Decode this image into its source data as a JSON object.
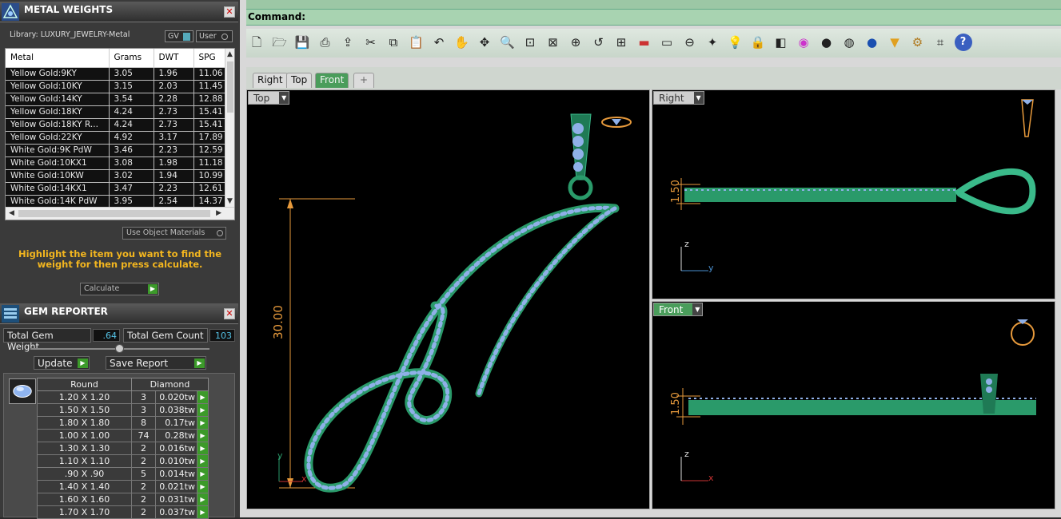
{
  "metal_panel": {
    "title": "METAL WEIGHTS",
    "library_label": "Library: LUXURY_JEWELRY-Metal",
    "toggle_gv": "GV",
    "toggle_user": "User",
    "columns": [
      "Metal",
      "Grams",
      "DWT",
      "SPG"
    ],
    "rows": [
      [
        "Yellow Gold:9KY",
        "3.05",
        "1.96",
        "11.06"
      ],
      [
        "Yellow Gold:10KY",
        "3.15",
        "2.03",
        "11.45"
      ],
      [
        "Yellow Gold:14KY",
        "3.54",
        "2.28",
        "12.88"
      ],
      [
        "Yellow Gold:18KY",
        "4.24",
        "2.73",
        "15.41"
      ],
      [
        "Yellow Gold:18KY R...",
        "4.24",
        "2.73",
        "15.41"
      ],
      [
        "Yellow Gold:22KY",
        "4.92",
        "3.17",
        "17.89"
      ],
      [
        "White Gold:9K PdW",
        "3.46",
        "2.23",
        "12.59"
      ],
      [
        "White Gold:10KX1",
        "3.08",
        "1.98",
        "11.18"
      ],
      [
        "White Gold:10KW",
        "3.02",
        "1.94",
        "10.99"
      ],
      [
        "White Gold:14KX1",
        "3.47",
        "2.23",
        "12.61"
      ],
      [
        "White Gold:14K PdW",
        "3.95",
        "2.54",
        "14.37"
      ]
    ],
    "use_object_materials": "Use Object Materials",
    "hint": "Highlight the item you want to find the weight for then press calculate.",
    "calculate": "Calculate"
  },
  "gem_panel": {
    "title": "GEM REPORTER",
    "total_weight_label": "Total Gem Weight",
    "total_weight_value": ".64",
    "total_count_label": "Total Gem Count",
    "total_count_value": "103",
    "update": "Update",
    "save_report": "Save Report",
    "header_shape": "Round",
    "header_type": "Diamond",
    "rows": [
      [
        "1.20 X 1.20",
        "3",
        "0.020tw"
      ],
      [
        "1.50 X 1.50",
        "3",
        "0.038tw"
      ],
      [
        "1.80 X 1.80",
        "8",
        "0.17tw"
      ],
      [
        "1.00 X 1.00",
        "74",
        "0.28tw"
      ],
      [
        "1.30 X 1.30",
        "2",
        "0.016tw"
      ],
      [
        "1.10 X 1.10",
        "2",
        "0.010tw"
      ],
      [
        ".90 X .90",
        "5",
        "0.014tw"
      ],
      [
        "1.40 X 1.40",
        "2",
        "0.021tw"
      ],
      [
        "1.60 X 1.60",
        "2",
        "0.031tw"
      ],
      [
        "1.70 X 1.70",
        "2",
        "0.037tw"
      ]
    ]
  },
  "command": {
    "label": "Command:"
  },
  "toolbar_icons": [
    "new-file-icon",
    "open-folder-icon",
    "save-icon",
    "print-icon",
    "export-icon",
    "cut-icon",
    "copy-icon",
    "paste-icon",
    "undo-icon",
    "pan-hand-icon",
    "rotate-view-icon",
    "zoom-icon",
    "zoom-window-icon",
    "zoom-extents-icon",
    "zoom-selected-icon",
    "undo-view-icon",
    "four-viewports-icon",
    "car-icon",
    "car-outline-icon",
    "dimension-icon",
    "point-icon",
    "lightbulb-icon",
    "lock-icon",
    "layers-icon",
    "color-wheel-icon",
    "sphere-gray-icon",
    "sphere-shaded-icon",
    "sphere-blue-icon",
    "spotlight-icon",
    "gear-icon",
    "snap-icon",
    "help-icon"
  ],
  "view_tabs": [
    "Right",
    "Top",
    "Front"
  ],
  "active_tab": "Front",
  "viewports": {
    "top": {
      "label": "Top",
      "dim_height": "30.00",
      "axis_x": "x",
      "axis_y": "y"
    },
    "right": {
      "label": "Right",
      "dim_thickness": "1.50",
      "axis_z": "z",
      "axis_y": "y"
    },
    "front": {
      "label": "Front",
      "dim_thickness": "1.50",
      "axis_z": "z",
      "axis_x": "x"
    }
  },
  "colors": {
    "jewel_green": "#2a9a6a",
    "gem_blue": "#8fb0e8",
    "dim_orange": "#e79a3c",
    "cmd_green": "#a8d3b1"
  }
}
